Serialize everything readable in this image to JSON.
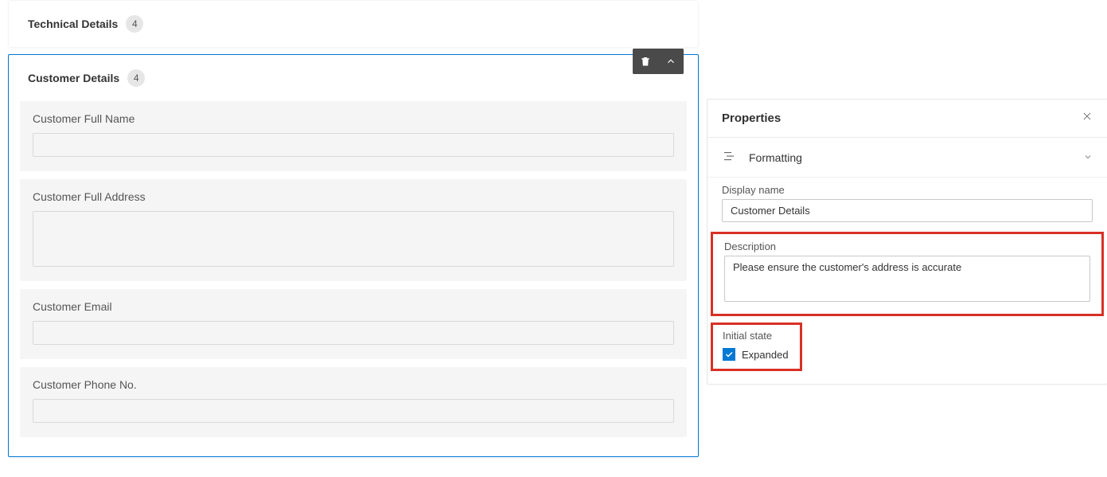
{
  "sections": {
    "technical": {
      "title": "Technical Details",
      "count": "4"
    },
    "customer": {
      "title": "Customer Details",
      "count": "4",
      "fields": [
        {
          "label": "Customer Full Name",
          "multiline": false
        },
        {
          "label": "Customer Full Address",
          "multiline": true
        },
        {
          "label": "Customer Email",
          "multiline": false
        },
        {
          "label": "Customer Phone No.",
          "multiline": false
        }
      ]
    }
  },
  "properties": {
    "panel_title": "Properties",
    "formatting_label": "Formatting",
    "display_name_label": "Display name",
    "display_name_value": "Customer Details",
    "description_label": "Description",
    "description_value": "Please ensure the customer's address is accurate",
    "initial_state_label": "Initial state",
    "expanded_label": "Expanded",
    "expanded_checked": true
  }
}
